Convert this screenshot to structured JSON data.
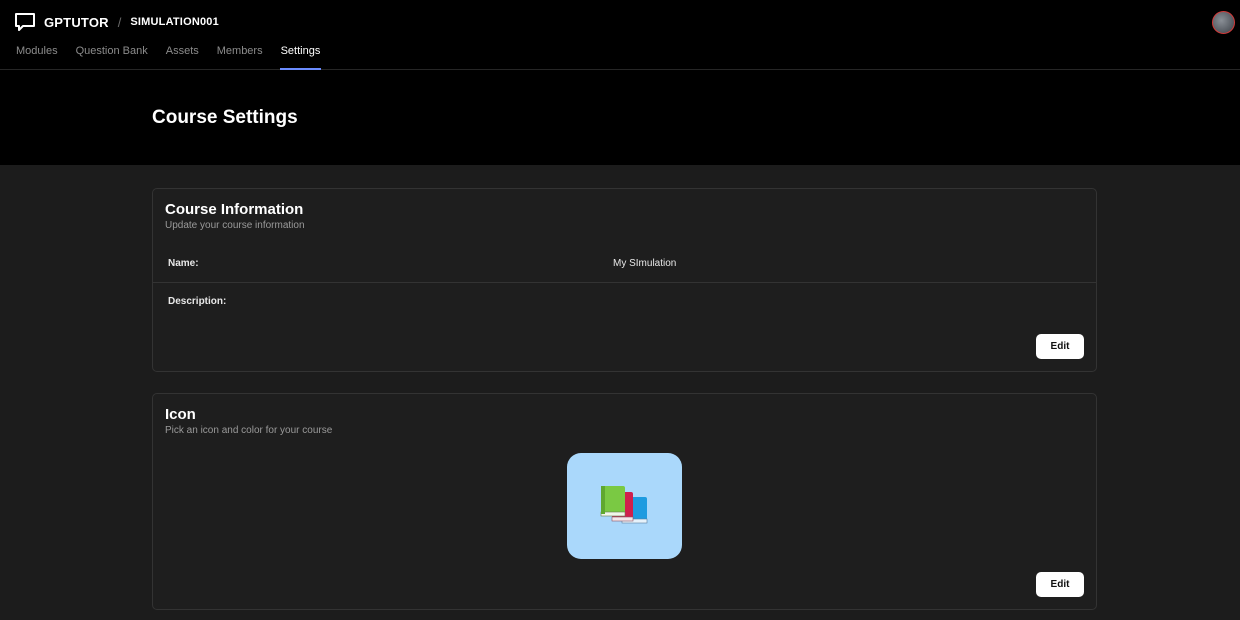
{
  "app": {
    "brand": "GPTUTOR",
    "breadcrumb_separator": "/",
    "course_code": "SIMULATION001"
  },
  "nav": {
    "tabs": [
      {
        "label": "Modules",
        "active": false
      },
      {
        "label": "Question Bank",
        "active": false
      },
      {
        "label": "Assets",
        "active": false
      },
      {
        "label": "Members",
        "active": false
      },
      {
        "label": "Settings",
        "active": true
      }
    ]
  },
  "page": {
    "title": "Course Settings"
  },
  "course_info": {
    "title": "Course Information",
    "subtitle": "Update your course information",
    "name_label": "Name:",
    "name_value": "My SImulation",
    "description_label": "Description:",
    "description_value": "",
    "edit_label": "Edit"
  },
  "icon_section": {
    "title": "Icon",
    "subtitle": "Pick an icon and color for your course",
    "icon": "books-icon",
    "tile_color": "#aad8fb",
    "edit_label": "Edit"
  },
  "colors": {
    "accent": "#6b8cff",
    "background": "#1c1c1c",
    "header": "#000000"
  }
}
